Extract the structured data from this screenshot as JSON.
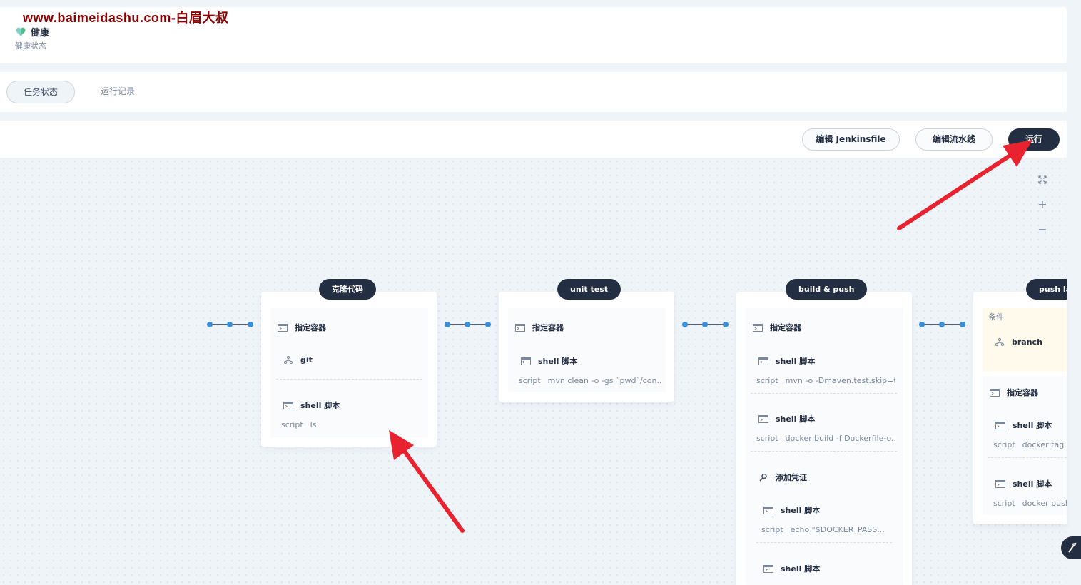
{
  "watermark": "www.baimeidashu.com-白眉大叔",
  "health": {
    "title": "健康",
    "subtitle": "健康状态",
    "icon": "heart-icon",
    "color": "#55bc8a"
  },
  "tabs": [
    {
      "label": "任务状态",
      "active": true
    },
    {
      "label": "运行记录",
      "active": false
    }
  ],
  "toolbar": {
    "edit_jenkinsfile": "编辑 Jenkinsfile",
    "edit_pipeline": "编辑流水线",
    "run": "运行"
  },
  "zoom": {
    "fit_icon": "expand-icon",
    "zoom_in": "+",
    "zoom_out": "−"
  },
  "stages": [
    {
      "title": "克隆代码",
      "container": "指定容器",
      "steps": [
        {
          "name": "git",
          "icon": "branch-icon"
        },
        {
          "name": "shell 脚本",
          "icon": "terminal-icon",
          "script_key": "script",
          "script": "ls"
        }
      ]
    },
    {
      "title": "unit test",
      "container": "指定容器",
      "steps": [
        {
          "name": "shell 脚本",
          "icon": "terminal-icon",
          "script_key": "script",
          "script": "mvn clean -o -gs `pwd`/con..."
        }
      ]
    },
    {
      "title": "build & push",
      "container": "指定容器",
      "steps": [
        {
          "name": "shell 脚本",
          "icon": "terminal-icon",
          "script_key": "script",
          "script": "mvn -o -Dmaven.test.skip=t..."
        },
        {
          "name": "shell 脚本",
          "icon": "terminal-icon",
          "script_key": "script",
          "script": "docker build -f Dockerfile-o..."
        },
        {
          "name": "添加凭证",
          "icon": "key-icon"
        },
        {
          "name": "shell 脚本",
          "icon": "terminal-icon",
          "script_key": "script",
          "script": "echo \"$DOCKER_PASS..."
        },
        {
          "name": "shell 脚本",
          "icon": "terminal-icon"
        }
      ]
    },
    {
      "title": "push la",
      "condition_label": "条件",
      "condition": "branch",
      "container": "指定容器",
      "steps": [
        {
          "name": "shell 脚本",
          "icon": "terminal-icon",
          "script_key": "script",
          "script": "docker tag $I"
        },
        {
          "name": "shell 脚本",
          "icon": "terminal-icon",
          "script_key": "script",
          "script": "docker push"
        }
      ]
    }
  ],
  "colors": {
    "dark": "#242e42",
    "connector": "#3a8fd6",
    "annotation_arrow": "#e8222f",
    "watermark": "#8b0000"
  }
}
